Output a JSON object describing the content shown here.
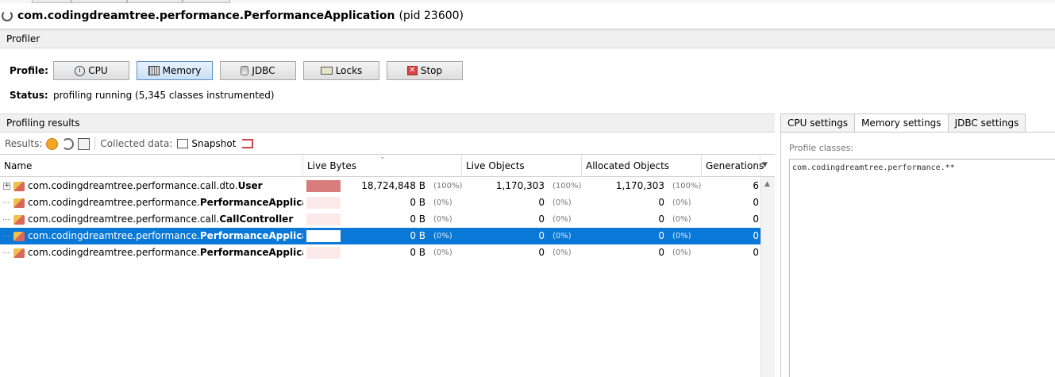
{
  "window": {
    "title": "com.codingdreamtree.performance.PerformanceApplication",
    "pid": "(pid 23600)"
  },
  "profiler": {
    "section_title": "Profiler",
    "profile_label": "Profile:",
    "buttons": {
      "cpu": "CPU",
      "memory": "Memory",
      "jdbc": "JDBC",
      "locks": "Locks",
      "stop": "Stop"
    },
    "active_button": "memory",
    "status_label": "Status:",
    "status_text": "profiling running (5,345 classes instrumented)"
  },
  "results": {
    "section_title": "Profiling results",
    "toolbar": {
      "results_label": "Results:",
      "collected_label": "Collected data:",
      "snapshot_label": "Snapshot"
    },
    "columns": {
      "name": "Name",
      "live_bytes": "Live Bytes",
      "live_objects": "Live Objects",
      "allocated_objects": "Allocated Objects",
      "generations": "Generations"
    },
    "rows": [
      {
        "prefix": "com.codingdreamtree.performance.call.dto.",
        "bold": "User",
        "live_bytes": "18,724,848 B",
        "live_bytes_pct": "(100%)",
        "live_bytes_fraction": 1.0,
        "live_objects": "1,170,303",
        "live_objects_pct": "(100%)",
        "allocated": "1,170,303",
        "allocated_pct": "(100%)",
        "generations": "6",
        "expandable": true,
        "selected": false
      },
      {
        "prefix": "com.codingdreamtree.performance.",
        "bold": "PerformanceApplication$$",
        "live_bytes": "0 B",
        "live_bytes_pct": "(0%)",
        "live_bytes_fraction": 0,
        "live_objects": "0",
        "live_objects_pct": "(0%)",
        "allocated": "0",
        "allocated_pct": "(0%)",
        "generations": "0",
        "expandable": false,
        "selected": false
      },
      {
        "prefix": "com.codingdreamtree.performance.call.",
        "bold": "CallController",
        "live_bytes": "0 B",
        "live_bytes_pct": "(0%)",
        "live_bytes_fraction": 0,
        "live_objects": "0",
        "live_objects_pct": "(0%)",
        "allocated": "0",
        "allocated_pct": "(0%)",
        "generations": "0",
        "expandable": false,
        "selected": false
      },
      {
        "prefix": "com.codingdreamtree.performance.",
        "bold": "PerformanceApplication",
        "live_bytes": "0 B",
        "live_bytes_pct": "(0%)",
        "live_bytes_fraction": 0,
        "live_objects": "0",
        "live_objects_pct": "(0%)",
        "allocated": "0",
        "allocated_pct": "(0%)",
        "generations": "0",
        "expandable": false,
        "selected": true
      },
      {
        "prefix": "com.codingdreamtree.performance.",
        "bold": "PerformanceApplication",
        "live_bytes": "0 B",
        "live_bytes_pct": "(0%)",
        "live_bytes_fraction": 0,
        "live_objects": "0",
        "live_objects_pct": "(0%)",
        "allocated": "0",
        "allocated_pct": "(0%)",
        "generations": "0",
        "expandable": false,
        "selected": false
      }
    ]
  },
  "settings": {
    "tabs": [
      "CPU settings",
      "Memory settings",
      "JDBC settings"
    ],
    "active_tab": 1,
    "profile_classes_label": "Profile classes:",
    "profile_classes_value": "com.codingdreamtree.performance.**"
  },
  "colors": {
    "selection": "#0a78d7",
    "bar_fill": "#d97c7c",
    "bar_bg": "#fbeaea"
  }
}
